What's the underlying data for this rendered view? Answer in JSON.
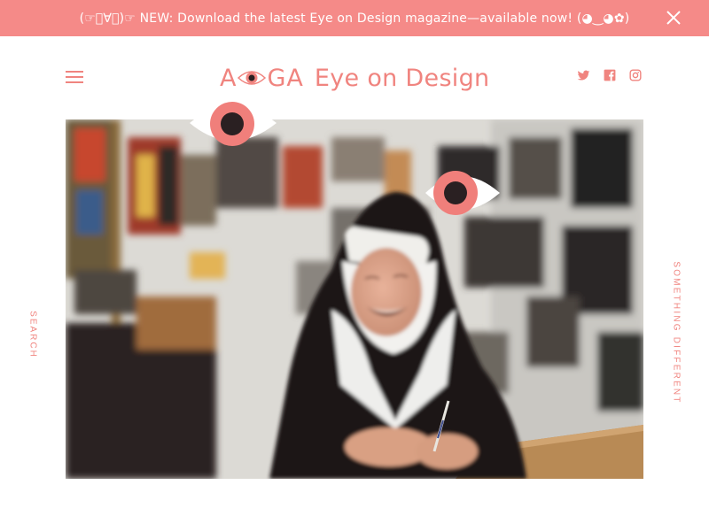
{
  "banner": {
    "text": "(☞ﾟ∀ﾟ)☞ NEW: Download the latest Eye on Design magazine—available now! (◕‿◕✿)",
    "close_icon": "close-icon",
    "background": "#f58a88"
  },
  "header": {
    "menu_icon": "hamburger-menu-icon",
    "logo": {
      "brand": "AIGA",
      "title": "Eye on Design"
    },
    "social": [
      "twitter-icon",
      "facebook-icon",
      "instagram-icon"
    ]
  },
  "side_links": {
    "left": "SEARCH",
    "right": "SOMETHING DIFFERENT"
  },
  "hero": {
    "image_subject": "photo-of-smiling-nun-at-desk"
  },
  "colors": {
    "accent": "#f0847f",
    "eye_iris": "#f07f7b",
    "eye_pupil": "#2a2022"
  }
}
